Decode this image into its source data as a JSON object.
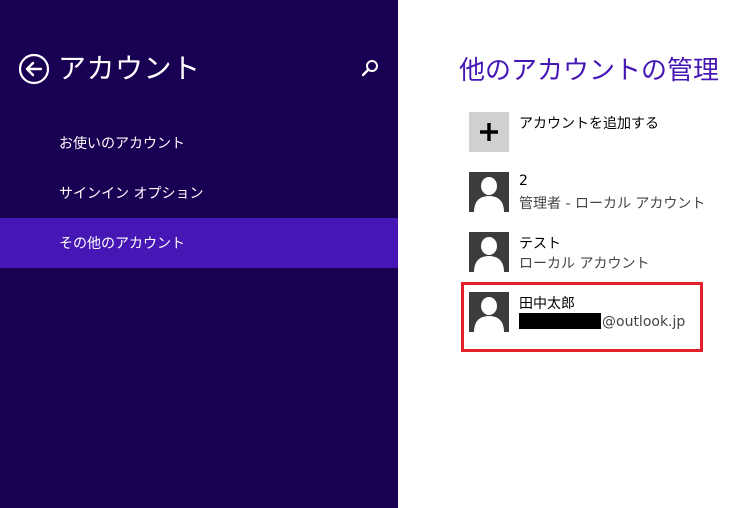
{
  "header": {
    "title": "アカウント"
  },
  "nav": {
    "items": [
      {
        "label": "お使いのアカウント"
      },
      {
        "label": "サインイン オプション"
      },
      {
        "label": "その他のアカウント"
      }
    ],
    "selected_index": 2
  },
  "main": {
    "title": "他のアカウントの管理",
    "add_account": {
      "label": "アカウントを追加する"
    },
    "accounts": [
      {
        "name": "2",
        "detail": "管理者 - ローカル アカウント"
      },
      {
        "name": "テスト",
        "detail": "ローカル アカウント"
      },
      {
        "name": "田中太郎",
        "detail": "@outlook.jp",
        "detail_redacted": true
      }
    ],
    "highlighted_account_index": 2
  },
  "colors": {
    "sidebar_bg": "#180052",
    "selected_bg": "#4617b4",
    "accent": "#4617b4",
    "highlight_border": "#e0202a"
  },
  "icons": {
    "back": "back-arrow-circle-icon",
    "search": "search-icon",
    "add": "plus-icon",
    "user": "user-silhouette-icon"
  }
}
